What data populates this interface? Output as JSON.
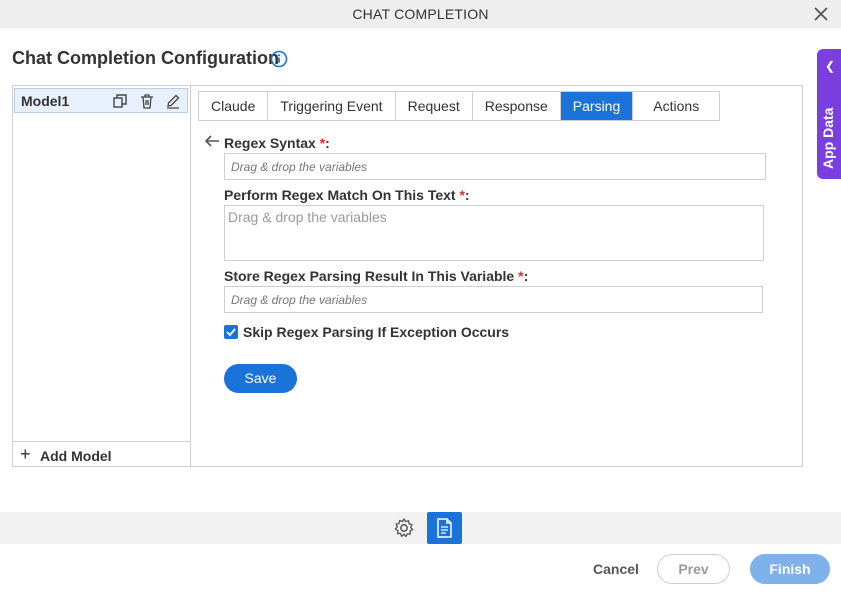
{
  "window": {
    "title": "CHAT COMPLETION"
  },
  "page": {
    "title": "Chat Completion Configuration"
  },
  "app_data": {
    "label": "App Data"
  },
  "models": {
    "items": [
      {
        "name": "Model1"
      }
    ],
    "add_label": "Add Model"
  },
  "tabs": [
    {
      "label": "Claude",
      "active": false
    },
    {
      "label": "Triggering Event",
      "active": false
    },
    {
      "label": "Request",
      "active": false
    },
    {
      "label": "Response",
      "active": false
    },
    {
      "label": "Parsing",
      "active": true
    },
    {
      "label": "Actions",
      "active": false
    }
  ],
  "form": {
    "regex_syntax": {
      "label": "Regex Syntax",
      "required": "*",
      "placeholder": "Drag & drop the variables"
    },
    "match_text": {
      "label": "Perform Regex Match On This Text",
      "required": "*",
      "placeholder": "Drag & drop the variables"
    },
    "store_result": {
      "label": "Store Regex Parsing Result In This Variable",
      "required": "*",
      "placeholder": "Drag & drop the variables"
    },
    "skip_exception": {
      "label": "Skip Regex Parsing If Exception Occurs",
      "checked": true
    },
    "save_label": "Save"
  },
  "footer": {
    "cancel": "Cancel",
    "prev": "Prev",
    "finish": "Finish"
  },
  "colors": {
    "accent": "#1a73d9",
    "app_data": "#7b3fe0",
    "required": "#d32f2f"
  },
  "icons": [
    "close-icon",
    "info-icon",
    "chevron-left-icon",
    "copy-icon",
    "trash-icon",
    "edit-icon",
    "plus-icon",
    "back-arrow-icon",
    "checkmark-icon",
    "gear-icon",
    "document-icon"
  ]
}
